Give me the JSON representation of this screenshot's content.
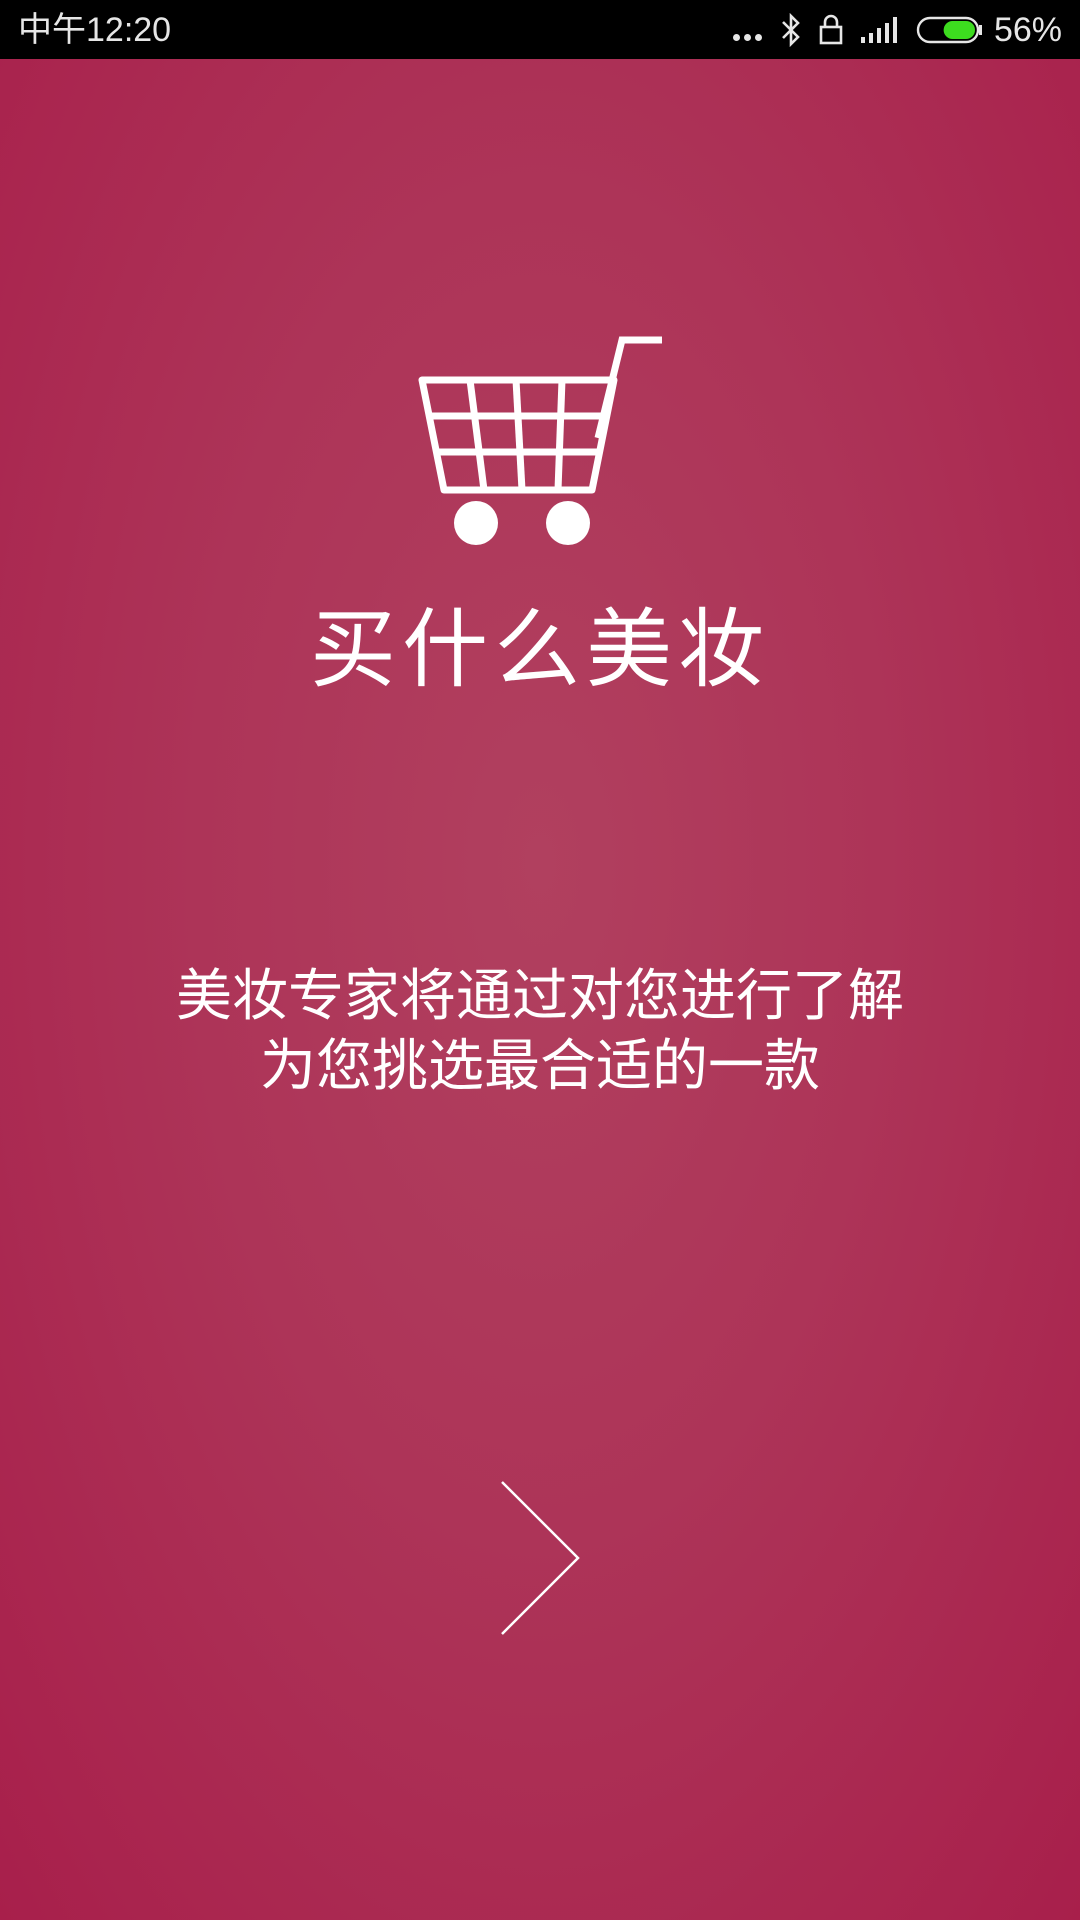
{
  "status_bar": {
    "time": "中午12:20",
    "battery_percent": "56%",
    "battery_level": 0.56,
    "icons": [
      "more-dots-icon",
      "bluetooth-icon",
      "lock-rotation-icon",
      "signal-icon",
      "battery-icon"
    ],
    "battery_color": "#3ddc1f"
  },
  "main": {
    "title": "买什么美妆",
    "description_lines": [
      "美妆专家将通过对您进行了解",
      "为您挑选最合适的一款"
    ],
    "icon": "shopping-cart-icon",
    "next_icon": "chevron-right-icon"
  },
  "colors": {
    "background": "#ad3458",
    "text": "#ffffff",
    "status_bar": "#000000"
  }
}
